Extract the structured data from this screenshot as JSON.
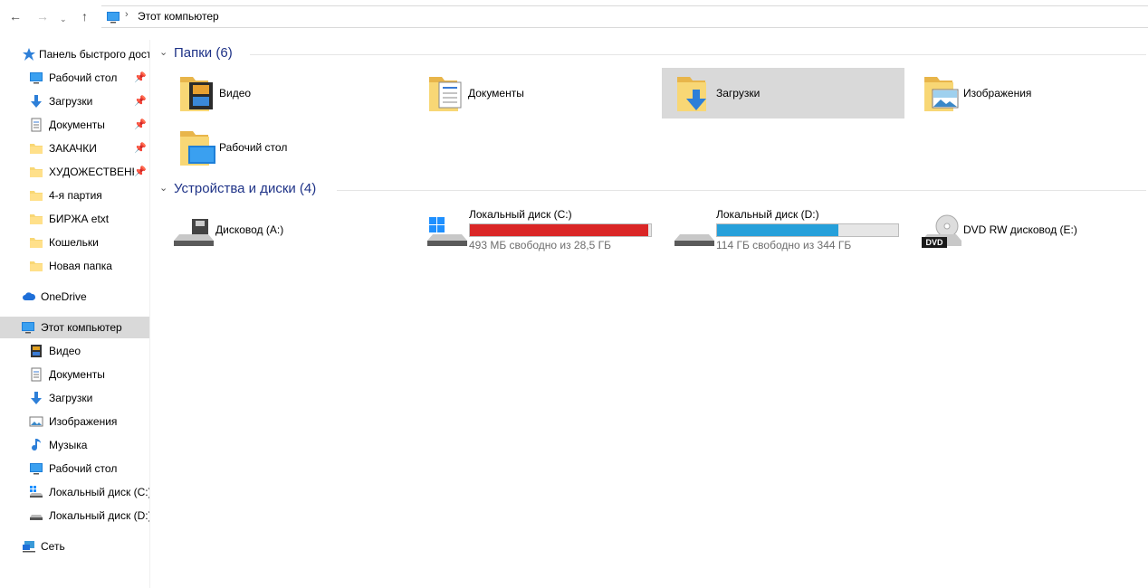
{
  "address": {
    "path": "Этот компьютер"
  },
  "sidebar": {
    "quick_access": "Панель быстрого доступа",
    "quick_items": [
      {
        "label": "Рабочий стол",
        "icon": "desktop-icon"
      },
      {
        "label": "Загрузки",
        "icon": "downloads-icon"
      },
      {
        "label": "Документы",
        "icon": "documents-icon"
      },
      {
        "label": "ЗАКАЧКИ",
        "icon": "folder-icon"
      },
      {
        "label": "ХУДОЖЕСТВЕННОЕ",
        "icon": "folder-icon"
      },
      {
        "label": "4-я партия",
        "icon": "folder-icon"
      },
      {
        "label": "БИРЖА etxt",
        "icon": "folder-icon"
      },
      {
        "label": "Кошельки",
        "icon": "folder-icon"
      },
      {
        "label": "Новая папка",
        "icon": "folder-icon"
      }
    ],
    "onedrive": "OneDrive",
    "this_pc": "Этот компьютер",
    "pc_items": [
      {
        "label": "Видео",
        "icon": "video-icon"
      },
      {
        "label": "Документы",
        "icon": "documents-icon"
      },
      {
        "label": "Загрузки",
        "icon": "downloads-icon"
      },
      {
        "label": "Изображения",
        "icon": "pictures-icon"
      },
      {
        "label": "Музыка",
        "icon": "music-icon"
      },
      {
        "label": "Рабочий стол",
        "icon": "desktop-icon"
      },
      {
        "label": "Локальный диск (C:)",
        "icon": "drive-c-icon"
      },
      {
        "label": "Локальный диск (D:)",
        "icon": "drive-d-icon"
      }
    ],
    "network": "Сеть"
  },
  "folders": {
    "title": "Папки (6)",
    "items": [
      {
        "label": "Видео"
      },
      {
        "label": "Документы"
      },
      {
        "label": "Загрузки"
      },
      {
        "label": "Изображения"
      },
      {
        "label": "Рабочий стол"
      }
    ]
  },
  "devices": {
    "title": "Устройства и диски (4)",
    "items": [
      {
        "label": "Дисковод (A:)"
      },
      {
        "label": "Локальный диск (C:)",
        "free": "493 МБ свободно из 28,5 ГБ",
        "used_fraction": 0.983,
        "bar_color": "#da2626"
      },
      {
        "label": "Локальный диск (D:)",
        "free": "114 ГБ свободно из 344 ГБ",
        "used_fraction": 0.669,
        "bar_color": "#26a0da"
      },
      {
        "label": "DVD RW дисковод (E:)"
      }
    ]
  },
  "colors": {
    "selection": "#d9d9d9",
    "group_title": "#1e3287",
    "folder": "#f8d775"
  }
}
